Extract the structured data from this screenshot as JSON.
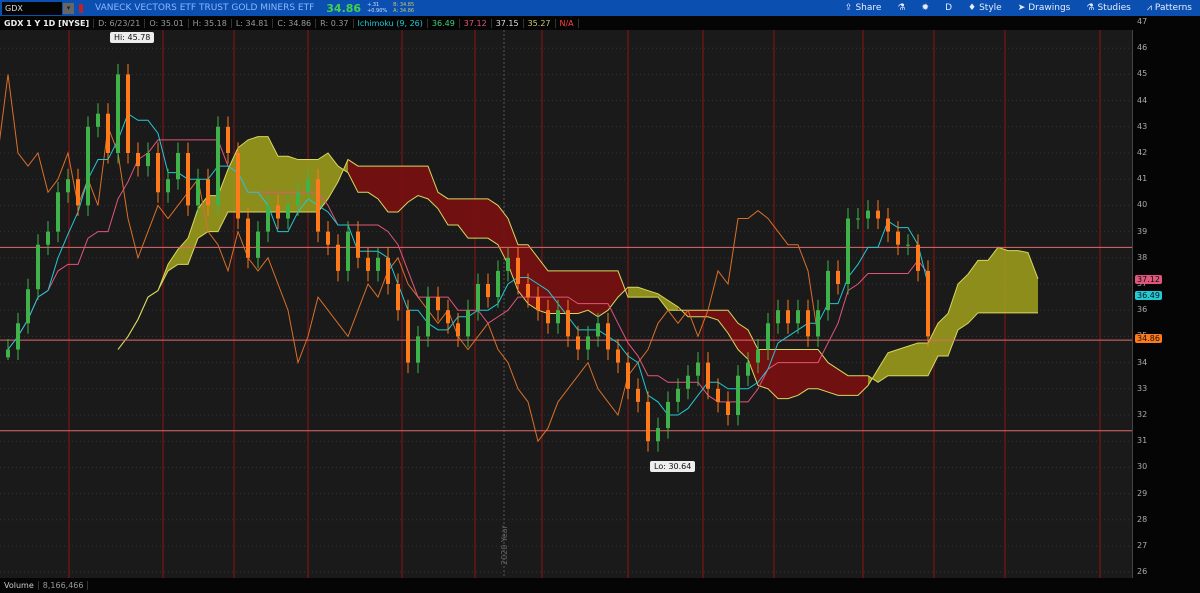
{
  "header": {
    "symbol": "GDX",
    "description": "VANECK VECTORS ETF TRUST GOLD MINERS ETF",
    "last": "34.86",
    "change": "+.31",
    "change_pct": "+0.90%",
    "bid": "B: 34.85",
    "ask": "A: 34.86"
  },
  "toolbar": {
    "share": "Share",
    "aggregation": "D",
    "style": "Style",
    "drawings": "Drawings",
    "studies": "Studies",
    "patterns": "Patterns"
  },
  "info": {
    "title": "GDX 1 Y 1D [NYSE]",
    "date": "D: 6/23/21",
    "open": "O: 35.01",
    "high": "H: 35.18",
    "low": "L: 34.81",
    "close": "C: 34.86",
    "range": "R: 0.37",
    "study": "Ichimoku (9, 26)",
    "tenkan": "36.49",
    "kijun": "37.12",
    "span_a": "37.15",
    "span_b": "35.27",
    "chikou": "N/A"
  },
  "volume": {
    "label": "Volume",
    "value": "8,166,466"
  },
  "colors": {
    "bull": "#3fb34a",
    "bear": "#ff7a1a",
    "tenkan": "#22c9d6",
    "kijun": "#e0567a",
    "chikou": "#d9702a",
    "cloud_up": "#9a9a1c",
    "cloud_down": "#7a1010"
  },
  "chart_data": {
    "type": "candlestick",
    "title": "GDX 1 Y 1D [NYSE]",
    "ylim": [
      25.5,
      47.5
    ],
    "yticks": [
      26,
      27,
      28,
      29,
      30,
      31,
      32,
      33,
      34,
      35,
      36,
      37,
      38,
      39,
      40,
      41,
      42,
      43,
      44,
      45,
      46,
      47
    ],
    "year_marker": "2020 Year",
    "hi_label": "Hi: 45.78",
    "lo_label": "Lo: 30.64",
    "hlines": [
      38.4,
      34.86,
      31.4
    ],
    "price_tags": [
      {
        "text": "37.12",
        "color": "#e0567a"
      },
      {
        "text": "36.49",
        "color": "#22c9d6"
      },
      {
        "text": "34.86",
        "color": "#ff7a1a"
      }
    ],
    "closes": [
      34.5,
      35.5,
      36.8,
      38.5,
      39,
      40.5,
      41,
      40,
      43,
      43.5,
      42,
      45,
      42,
      41.5,
      42,
      40.5,
      41,
      42,
      40,
      41,
      40,
      43,
      42,
      39.5,
      38,
      39,
      40,
      39.5,
      40,
      40.5,
      41,
      39,
      38.5,
      37.5,
      39,
      38,
      37.5,
      38,
      37,
      36,
      34,
      35,
      36.5,
      36,
      35.5,
      35,
      36,
      37,
      36.5,
      37.5,
      38,
      37,
      36.5,
      36,
      35.5,
      36,
      35,
      34.5,
      35,
      35.5,
      34.5,
      34,
      33,
      32.5,
      31,
      31.5,
      32.5,
      33,
      33.5,
      34,
      33,
      32.5,
      32,
      33.5,
      34,
      34.5,
      35.5,
      36,
      35.5,
      36,
      35,
      36,
      37.5,
      37,
      39.5,
      39.5,
      39.8,
      39.5,
      39,
      38.5,
      38.5,
      37.5,
      35
    ]
  }
}
